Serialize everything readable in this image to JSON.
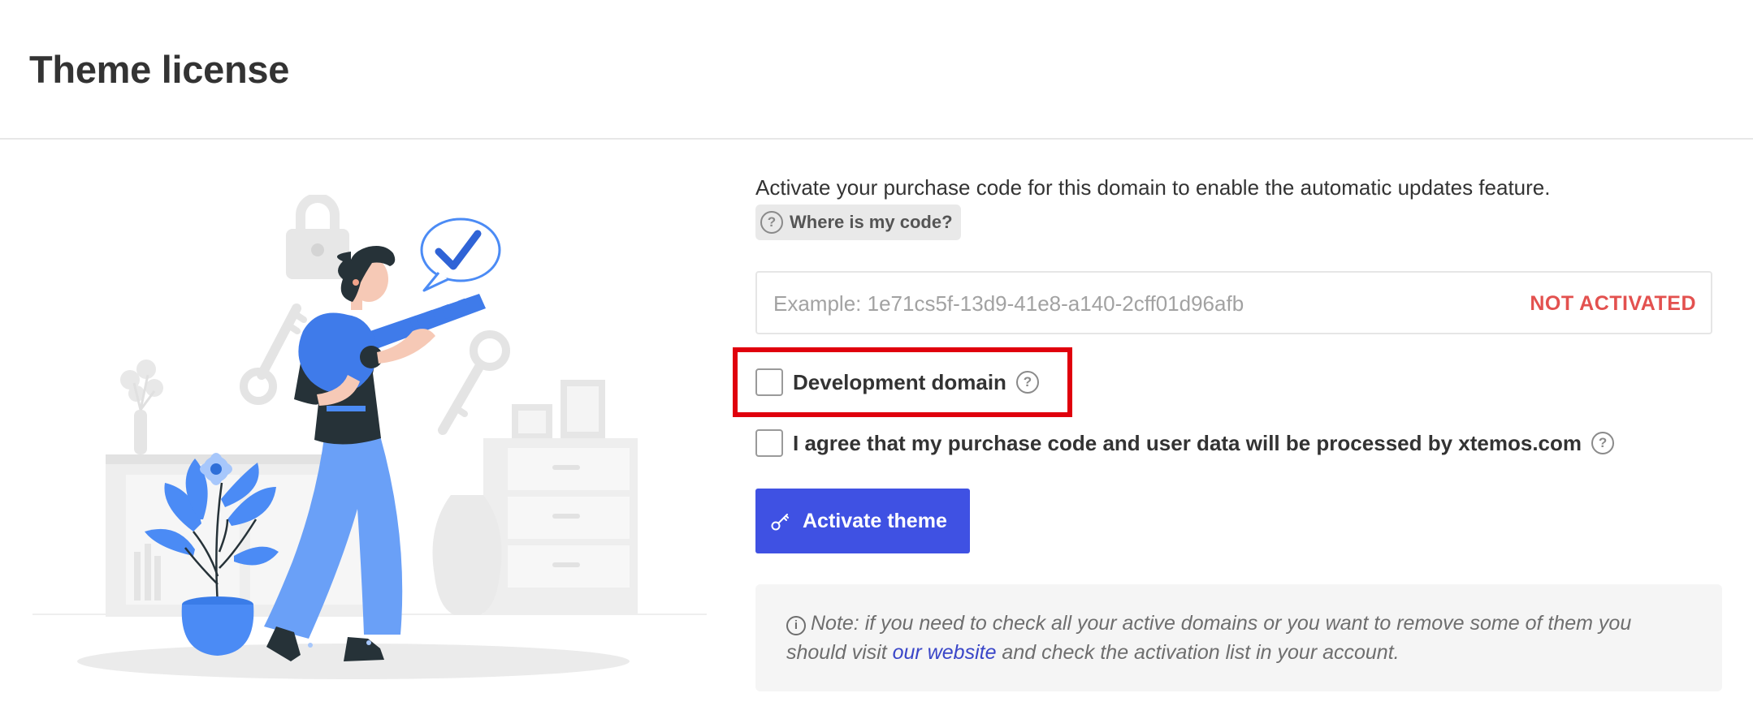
{
  "page": {
    "title": "Theme license"
  },
  "license": {
    "intro": "Activate your purchase code for this domain to enable the automatic updates feature.",
    "where_label": "Where is my code?",
    "code_placeholder": "Example: 1e71cs5f-13d9-41e8-a140-2cff01d96afb",
    "code_value": "",
    "status": "NOT ACTIVATED",
    "dev_domain_label": "Development domain",
    "dev_domain_checked": false,
    "agree_label": "I agree that my purchase code and user data will be processed by xtemos.com",
    "agree_checked": false,
    "activate_label": "Activate theme"
  },
  "note": {
    "prefix": "Note: if you need to check all your active domains or you want to remove some of them you should visit ",
    "link_text": "our website",
    "suffix": " and check the activation list in your account."
  },
  "icons": {
    "help": "question-circle-icon",
    "key": "key-icon",
    "info": "info-circle-icon"
  },
  "colors": {
    "accent": "#3f51e3",
    "status": "#e3514f",
    "highlight": "#e0000d",
    "illustration_blue": "#4b8bf5",
    "illustration_dark": "#263238",
    "link": "#3a46c8"
  }
}
